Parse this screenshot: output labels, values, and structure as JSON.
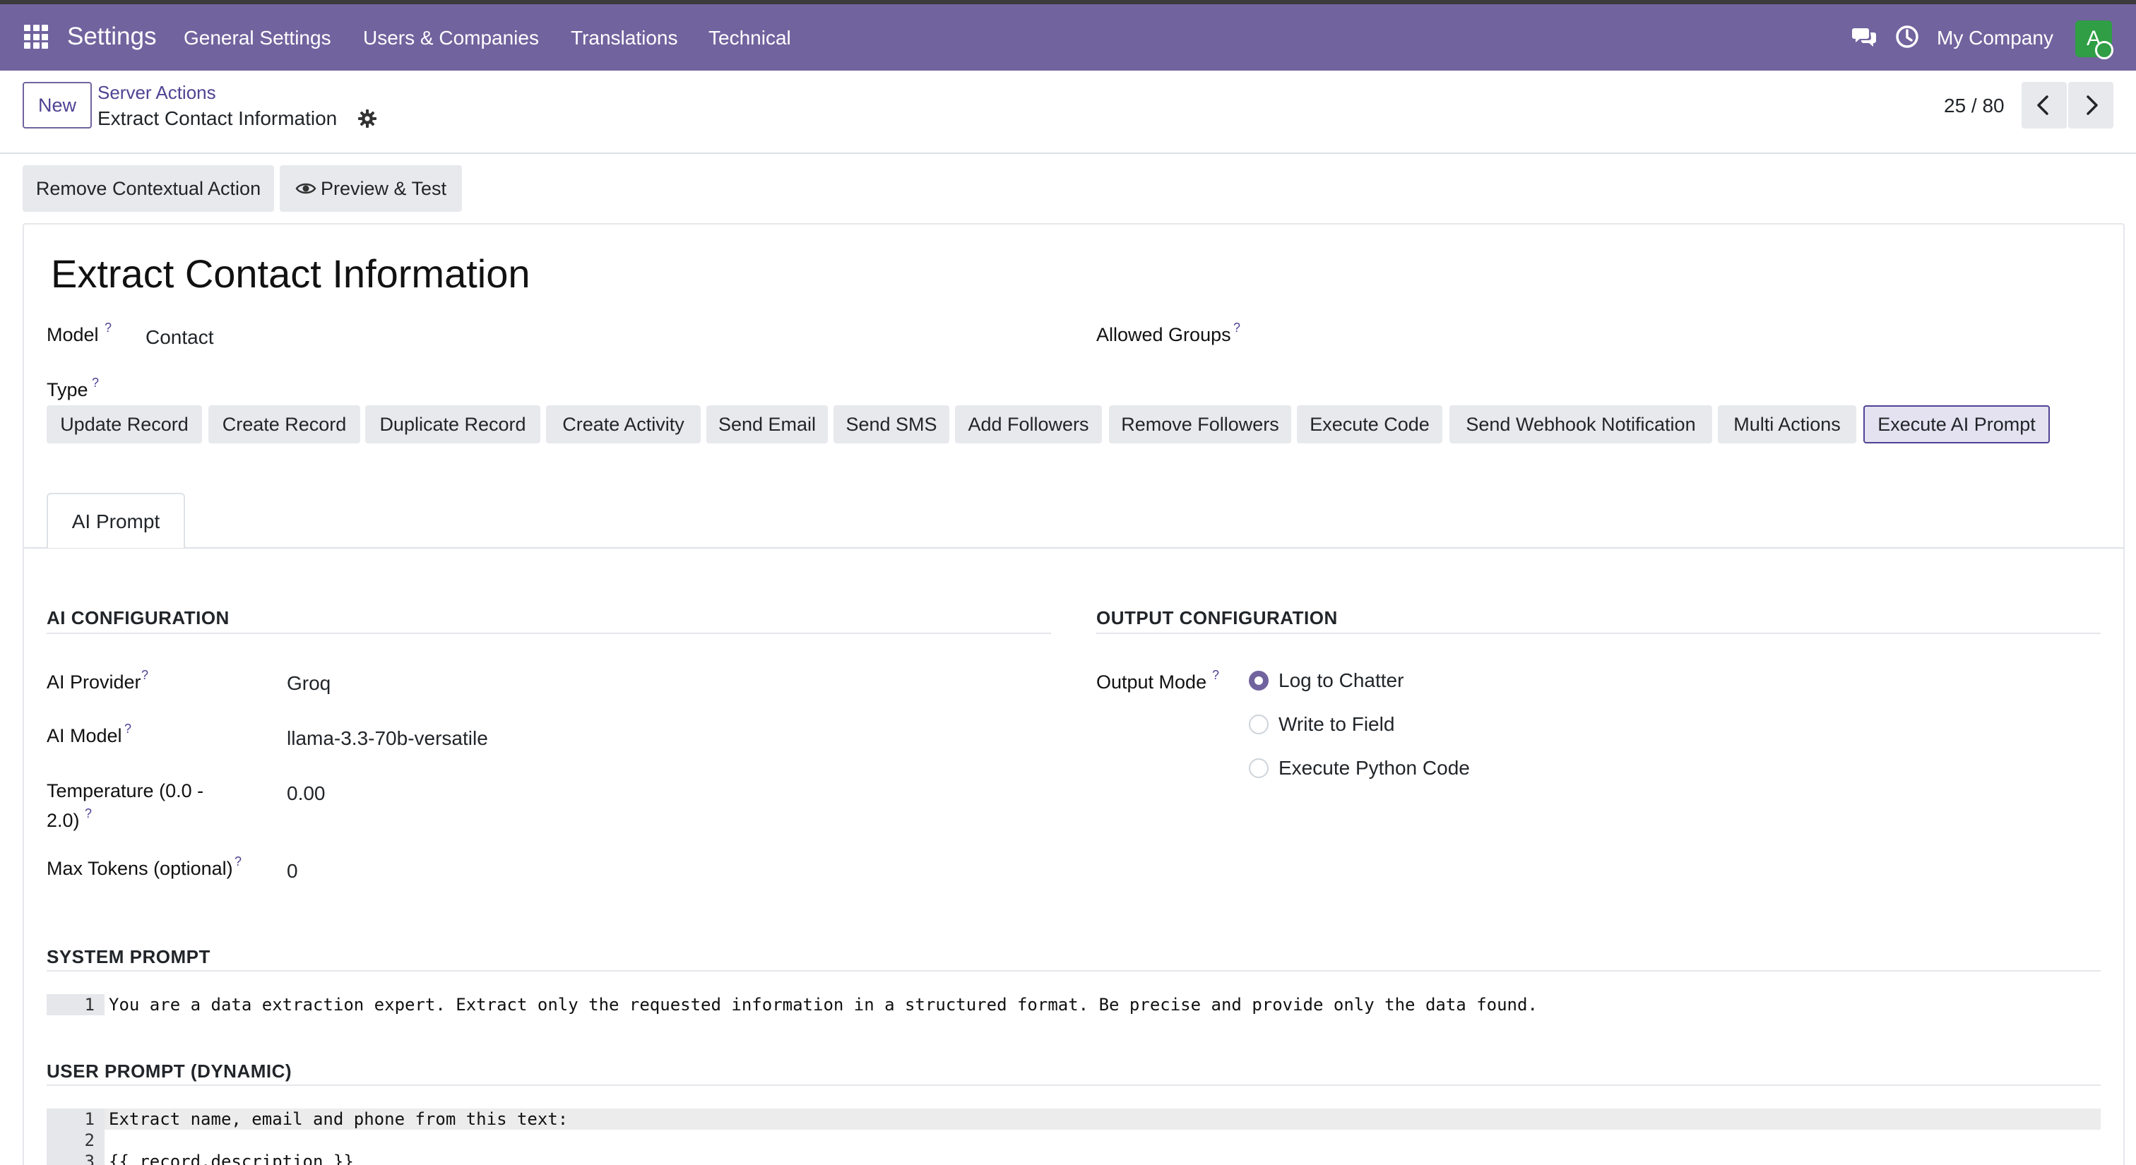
{
  "navbar": {
    "app_title": "Settings",
    "menus": [
      "General Settings",
      "Users & Companies",
      "Translations",
      "Technical"
    ],
    "company": "My Company",
    "avatar_letter": "A",
    "color": "#71639e"
  },
  "control_panel": {
    "new_label": "New",
    "breadcrumb_parent": "Server Actions",
    "breadcrumb_current": "Extract Contact Information",
    "pager": "25 / 80"
  },
  "status_buttons": {
    "remove_contextual": "Remove Contextual Action",
    "preview_test": "Preview & Test"
  },
  "form": {
    "title": "Extract Contact Information",
    "model_label": "Model",
    "model_value": "Contact",
    "allowed_groups_label": "Allowed Groups",
    "type_label": "Type",
    "types": [
      "Update Record",
      "Create Record",
      "Duplicate Record",
      "Create Activity",
      "Send Email",
      "Send SMS",
      "Add Followers",
      "Remove Followers",
      "Execute Code",
      "Send Webhook Notification",
      "Multi Actions",
      "Execute AI Prompt"
    ],
    "selected_type": "Execute AI Prompt"
  },
  "tabs": {
    "ai_prompt": "AI Prompt"
  },
  "ai_config": {
    "heading": "AI CONFIGURATION",
    "provider_label": "AI Provider",
    "provider_value": "Groq",
    "model_label": "AI Model",
    "model_value": "llama-3.3-70b-versatile",
    "temperature_label_1": "Temperature (0.0 -",
    "temperature_label_2": "2.0)",
    "temperature_value": "0.00",
    "max_tokens_label": "Max Tokens (optional)",
    "max_tokens_value": "0"
  },
  "output_config": {
    "heading": "OUTPUT CONFIGURATION",
    "mode_label": "Output Mode",
    "options": [
      "Log to Chatter",
      "Write to Field",
      "Execute Python Code"
    ],
    "selected": "Log to Chatter"
  },
  "system_prompt": {
    "heading": "SYSTEM PROMPT",
    "lines": [
      {
        "num": "1",
        "text": "You are a data extraction expert. Extract only the requested information in a structured format. Be precise and provide only the data found."
      }
    ]
  },
  "user_prompt": {
    "heading": "USER PROMPT (DYNAMIC)",
    "lines": [
      {
        "num": "1",
        "text": "Extract name, email and phone from this text:"
      },
      {
        "num": "2",
        "text": ""
      },
      {
        "num": "3",
        "text": "{{ record.description }}"
      }
    ]
  },
  "icons": {
    "apps": "apps-grid-icon",
    "chat": "chat-bubbles-icon",
    "activity": "clock-icon",
    "gear": "gear-icon",
    "eye": "eye-icon",
    "prev": "chevron-left-icon",
    "next": "chevron-right-icon"
  }
}
